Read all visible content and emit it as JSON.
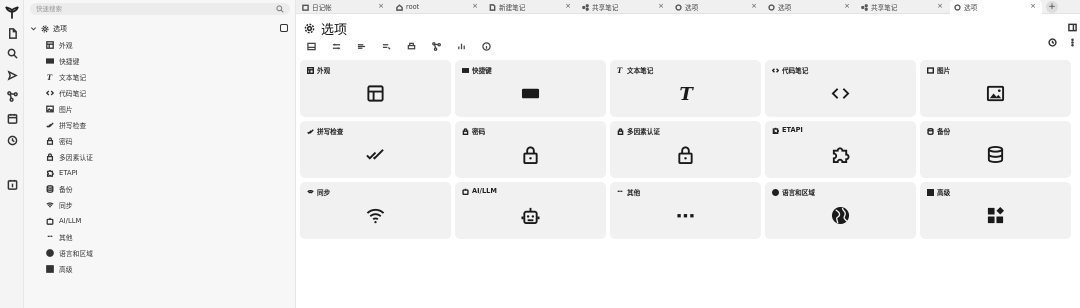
{
  "search": {
    "placeholder": "快速搜索"
  },
  "tree": {
    "root_label": "选项",
    "items": [
      {
        "label": "外观",
        "icon": "layout-icon"
      },
      {
        "label": "快捷键",
        "icon": "keyboard-icon"
      },
      {
        "label": "文本笔记",
        "icon": "text-icon"
      },
      {
        "label": "代码笔记",
        "icon": "code-icon"
      },
      {
        "label": "图片",
        "icon": "image-icon"
      },
      {
        "label": "拼写检查",
        "icon": "spellcheck-icon"
      },
      {
        "label": "密码",
        "icon": "lock-icon"
      },
      {
        "label": "多因素认证",
        "icon": "mfa-lock-icon"
      },
      {
        "label": "ETAPI",
        "icon": "etapi-icon"
      },
      {
        "label": "备份",
        "icon": "database-icon"
      },
      {
        "label": "同步",
        "icon": "wifi-icon"
      },
      {
        "label": "AI/LLM",
        "icon": "robot-icon"
      },
      {
        "label": "其他",
        "icon": "dots-icon"
      },
      {
        "label": "语言和区域",
        "icon": "globe-icon"
      },
      {
        "label": "高级",
        "icon": "widgets-icon"
      }
    ]
  },
  "tabs": [
    {
      "label": "日记帐",
      "icon": "calendar-icon"
    },
    {
      "label": "root",
      "icon": "home-icon"
    },
    {
      "label": "新建笔记",
      "icon": "note-icon"
    },
    {
      "label": "共享笔记",
      "icon": "share-icon"
    },
    {
      "label": "选项",
      "icon": "gear-icon"
    },
    {
      "label": "选项",
      "icon": "gear-icon"
    },
    {
      "label": "共享笔记",
      "icon": "share-icon"
    },
    {
      "label": "选项",
      "icon": "gear-icon",
      "active": true
    }
  ],
  "main": {
    "title": "选项",
    "cards": [
      {
        "label": "外观",
        "icon": "layout-icon"
      },
      {
        "label": "快捷键",
        "icon": "keyboard-icon"
      },
      {
        "label": "文本笔记",
        "icon": "text-icon"
      },
      {
        "label": "代码笔记",
        "icon": "code-icon"
      },
      {
        "label": "图片",
        "icon": "image-icon"
      },
      {
        "label": "拼写检查",
        "icon": "spellcheck-icon"
      },
      {
        "label": "密码",
        "icon": "lock-icon"
      },
      {
        "label": "多因素认证",
        "icon": "mfa-lock-icon"
      },
      {
        "label": "ETAPI",
        "icon": "etapi-icon"
      },
      {
        "label": "备份",
        "icon": "database-icon"
      },
      {
        "label": "同步",
        "icon": "wifi-icon"
      },
      {
        "label": "AI/LLM",
        "icon": "robot-icon"
      },
      {
        "label": "其他",
        "icon": "dots-icon"
      },
      {
        "label": "语言和区域",
        "icon": "globe-icon"
      },
      {
        "label": "高级",
        "icon": "widgets-icon"
      }
    ]
  }
}
